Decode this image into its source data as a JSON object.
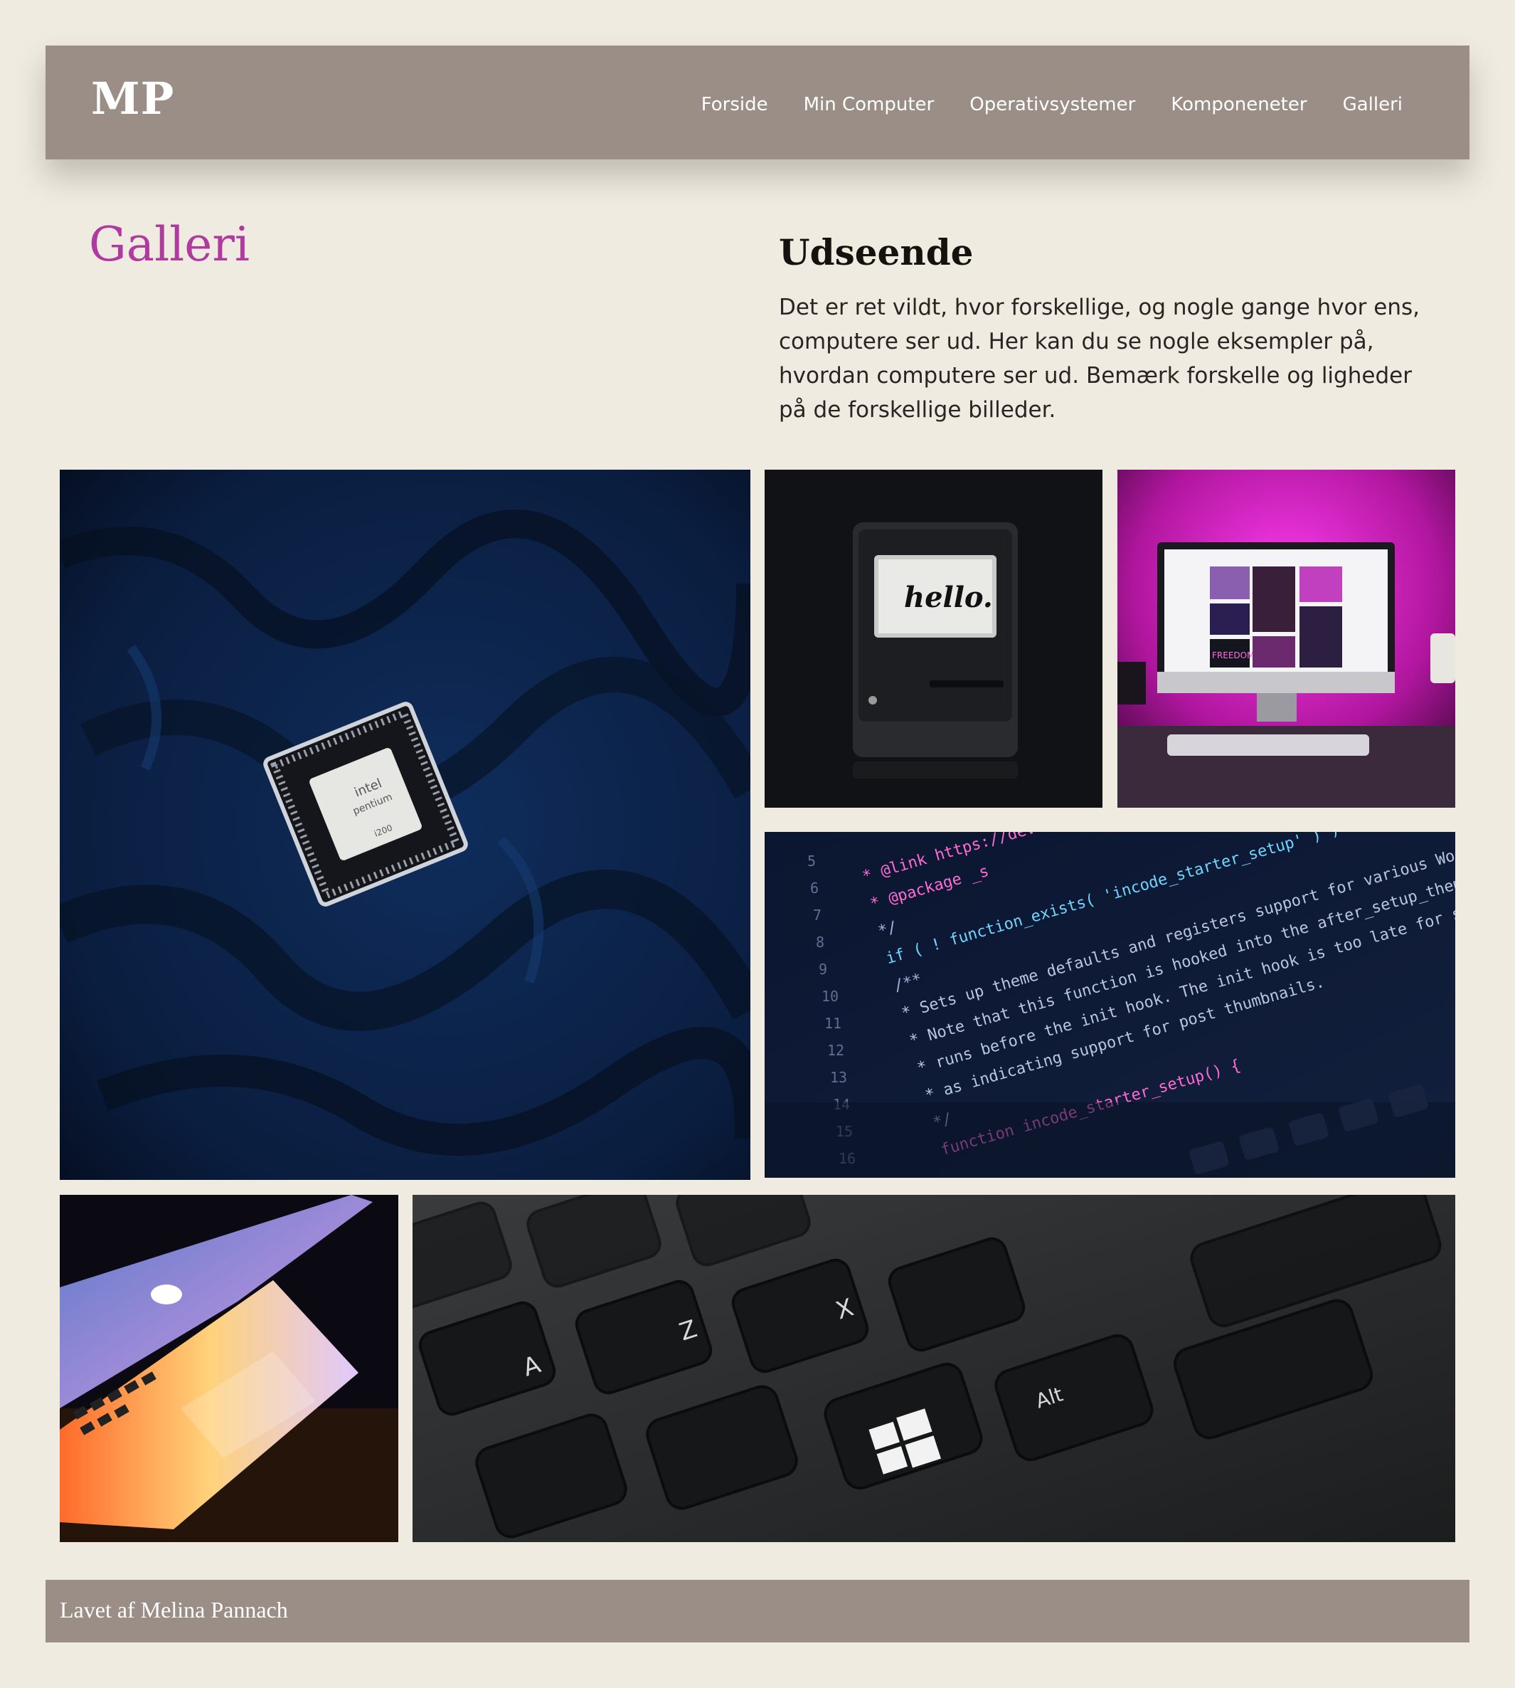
{
  "header": {
    "logo": "MP",
    "nav": [
      "Forside",
      "Min Computer",
      "Operativsystemer",
      "Komponeneter",
      "Galleri"
    ]
  },
  "page": {
    "title": "Galleri",
    "section_title": "Udseende",
    "intro": "Det er ret vildt, hvor forskellige, og nogle gange hvor ens, computere ser ud. Her kan du se nogle eksempler på, hvordan computere ser ud. Bemærk forskelle og ligheder på de forskellige billeder."
  },
  "gallery": {
    "cpu": {
      "chip_brand": "intel",
      "chip_model": "pentium",
      "chip_code": "i200"
    },
    "mac": {
      "screen_text": "hello."
    },
    "imac": {
      "poster_text": "FREEDOM"
    },
    "code": {
      "lines": [
        "* @link https://deve",
        "* @package _s",
        "*/",
        "if ( ! function_exists( 'incode_starter_setup' ) ) :",
        "/**",
        " * Sets up theme defaults and registers support for various WordPress features.",
        " * Note that this function is hooked into the after_setup_theme hook, which",
        " * runs before the init hook. The init hook is too late for some features,",
        " * as indicating support for post thumbnails.",
        " */",
        "function incode_starter_setup() {"
      ],
      "line_numbers": [
        "5",
        "6",
        "7",
        "8",
        "9",
        "10",
        "11",
        "12",
        "13",
        "14",
        "15",
        "16"
      ]
    },
    "keyboard": {
      "keys": [
        "A",
        "Z",
        "X",
        "Alt"
      ]
    }
  },
  "footer": {
    "text": "Lavet af Melina Pannach"
  },
  "colors": {
    "background": "#efebe1",
    "bar": "#9a8e86",
    "title_accent": "#b03aa0"
  }
}
